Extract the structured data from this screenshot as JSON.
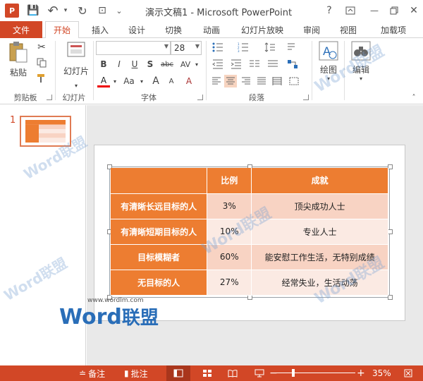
{
  "window": {
    "app_icon_text": "P",
    "title": "演示文稿1 - Microsoft PowerPoint",
    "help": "?",
    "minimize": "—",
    "close": "✕"
  },
  "qat": {
    "save": "💾",
    "undo": "↶",
    "redo": "↻",
    "presenter": "⊡",
    "more": "⌄"
  },
  "tabs": {
    "file": "文件",
    "items": [
      "开始",
      "插入",
      "设计",
      "切换",
      "动画",
      "幻灯片放映",
      "审阅",
      "视图",
      "加载项"
    ],
    "active": "开始"
  },
  "ribbon": {
    "clipboard": {
      "label": "剪贴板",
      "paste": "粘贴"
    },
    "slides": {
      "label": "幻灯片",
      "new_slide": "幻灯片"
    },
    "font": {
      "label": "字体",
      "font_name": "",
      "font_size": "28",
      "bold": "B",
      "italic": "I",
      "underline": "U",
      "shadow": "S",
      "strike": "abc",
      "spacing": "AV",
      "color": "A",
      "case": "Aa",
      "grow": "A",
      "shrink": "A",
      "clear": "A"
    },
    "paragraph": {
      "label": "段落"
    },
    "drawing": {
      "label": "绘图",
      "button": "绘图"
    },
    "editing": {
      "label": "编辑",
      "button": "编辑"
    }
  },
  "slides_pane": {
    "slide_number": "1"
  },
  "table": {
    "headers": [
      "",
      "比例",
      "成就"
    ],
    "rows": [
      {
        "label": "有清晰长远目标的人",
        "ratio": "3%",
        "result": "顶尖成功人士"
      },
      {
        "label": "有清晰短期目标的人",
        "ratio": "10%",
        "result": "专业人士"
      },
      {
        "label": "目标模糊者",
        "ratio": "60%",
        "result": "能安慰工作生活，无特别成绩"
      },
      {
        "label": "无目标的人",
        "ratio": "27%",
        "result": "经常失业，生活动荡"
      }
    ]
  },
  "watermark": {
    "url": "www.wordlm.com",
    "brand_en": "Word",
    "brand_cn": "联盟"
  },
  "statusbar": {
    "notes": "备注",
    "comments": "批注",
    "zoom": "35%",
    "minus": "−",
    "plus": "+"
  },
  "colors": {
    "accent": "#d24726",
    "table_header": "#ed7d31",
    "row_dark": "#f8d3c3",
    "row_light": "#fbeae3"
  }
}
